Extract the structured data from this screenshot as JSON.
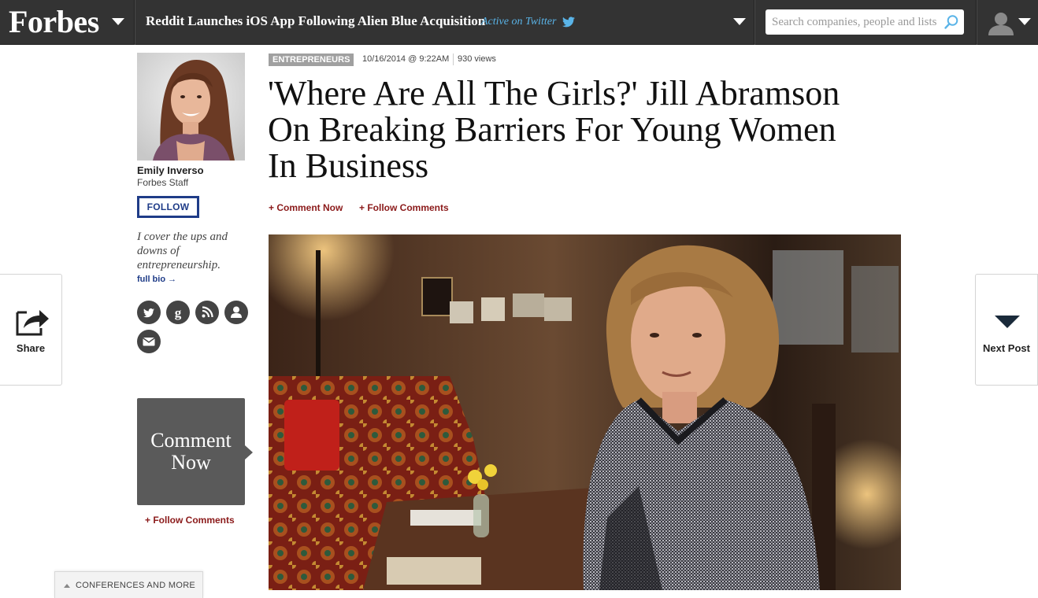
{
  "header": {
    "logo": "Forbes",
    "headline": "Reddit Launches iOS App Following Alien Blue Acquisition",
    "twitter_status": "Active on Twitter",
    "search_placeholder": "Search companies, people and lists"
  },
  "author": {
    "name": "Emily Inverso",
    "role": "Forbes Staff",
    "follow_label": "FOLLOW",
    "bio": "I cover the ups and downs of entrepreneurship.",
    "full_bio_label": "full bio →",
    "social_icons": [
      "twitter-icon",
      "google-plus-icon",
      "rss-icon",
      "profile-icon",
      "email-icon"
    ]
  },
  "article": {
    "category": "ENTREPRENEURS",
    "date": "10/16/2014 @ 9:22AM",
    "views": "930 views",
    "title": "'Where Are All The Girls?' Jill Abramson On Breaking Barriers For Young Women In Business",
    "comment_now": "+ Comment Now",
    "follow_comments": "+ Follow Comments"
  },
  "sidebar": {
    "comment_box": "Comment Now",
    "follow_comments": "+ Follow Comments"
  },
  "share_tab": {
    "label": "Share"
  },
  "next_tab": {
    "label": "Next Post"
  },
  "footer": {
    "conferences": "CONFERENCES AND MORE"
  },
  "colors": {
    "topbar": "#333333",
    "link_red": "#8b1a1a",
    "follow_blue": "#1f3c88",
    "twitter_blue": "#5ab4e8",
    "comment_box": "#5a5a5a"
  }
}
